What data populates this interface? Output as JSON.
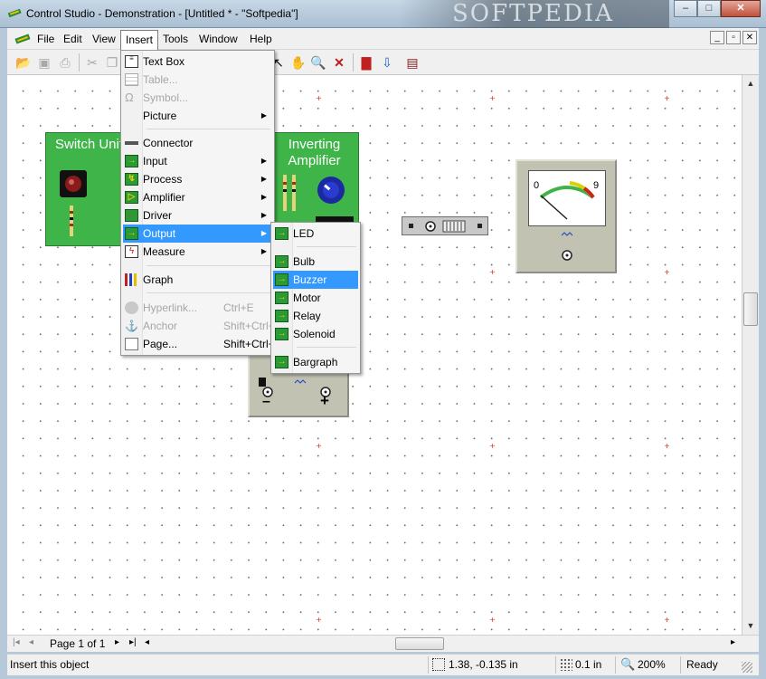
{
  "window": {
    "title": "Control Studio - Demonstration - [Untitled * - \"Softpedia\"]",
    "watermark": "SOFTPEDIA"
  },
  "window_controls": {
    "minimize": "–",
    "maximize": "□",
    "close": "✕"
  },
  "menubar": {
    "items": [
      "File",
      "Edit",
      "View",
      "Insert",
      "Tools",
      "Window",
      "Help"
    ]
  },
  "mdi_controls": {
    "minimize": "_",
    "restore": "▫",
    "close": "✕"
  },
  "insert_menu": {
    "items": [
      {
        "label": "Text Box",
        "disabled": false
      },
      {
        "label": "Table...",
        "disabled": true
      },
      {
        "label": "Symbol...",
        "disabled": true
      },
      {
        "label": "Picture",
        "disabled": false,
        "submenu": true
      },
      {
        "label": "Connector",
        "disabled": false
      },
      {
        "label": "Input",
        "disabled": false,
        "submenu": true
      },
      {
        "label": "Process",
        "disabled": false,
        "submenu": true
      },
      {
        "label": "Amplifier",
        "disabled": false,
        "submenu": true
      },
      {
        "label": "Driver",
        "disabled": false,
        "submenu": true
      },
      {
        "label": "Output",
        "disabled": false,
        "submenu": true,
        "highlighted": true
      },
      {
        "label": "Measure",
        "disabled": false,
        "submenu": true
      },
      {
        "label": "Graph",
        "disabled": false
      },
      {
        "label": "Hyperlink...",
        "shortcut": "Ctrl+E",
        "disabled": true
      },
      {
        "label": "Anchor",
        "shortcut": "Shift+Ctrl+A",
        "disabled": true
      },
      {
        "label": "Page...",
        "shortcut": "Shift+Ctrl+N",
        "disabled": false
      }
    ]
  },
  "output_submenu": {
    "items": [
      {
        "label": "LED"
      },
      {
        "label": "Bulb"
      },
      {
        "label": "Buzzer",
        "highlighted": true
      },
      {
        "label": "Motor"
      },
      {
        "label": "Relay"
      },
      {
        "label": "Solenoid"
      },
      {
        "label": "Bargraph"
      }
    ]
  },
  "canvas": {
    "switch_unit": {
      "title": "Switch Unit"
    },
    "inverting_amplifier": {
      "title_line1": "Inverting",
      "title_line2": "Amplifier"
    },
    "meter": {
      "scale_min": "0",
      "scale_max": "9"
    },
    "power_unit": {
      "minus": "–",
      "plus": "+"
    }
  },
  "page_nav": {
    "first": "|◂",
    "prev": "◂",
    "page_label": "Page 1 of 1",
    "next": "▸",
    "last": "▸|",
    "scroll_left": "◂",
    "scroll_right": "▸"
  },
  "scroll": {
    "up": "▲",
    "down": "▼"
  },
  "status": {
    "message": "Insert this object",
    "coords": "1.38, -0.135 in",
    "grid": "0.1 in",
    "zoom": "200%",
    "state": "Ready"
  },
  "colors": {
    "menu_highlight": "#3399ff",
    "module_green": "#3fb549",
    "grid_cross": "#e43a3a"
  }
}
